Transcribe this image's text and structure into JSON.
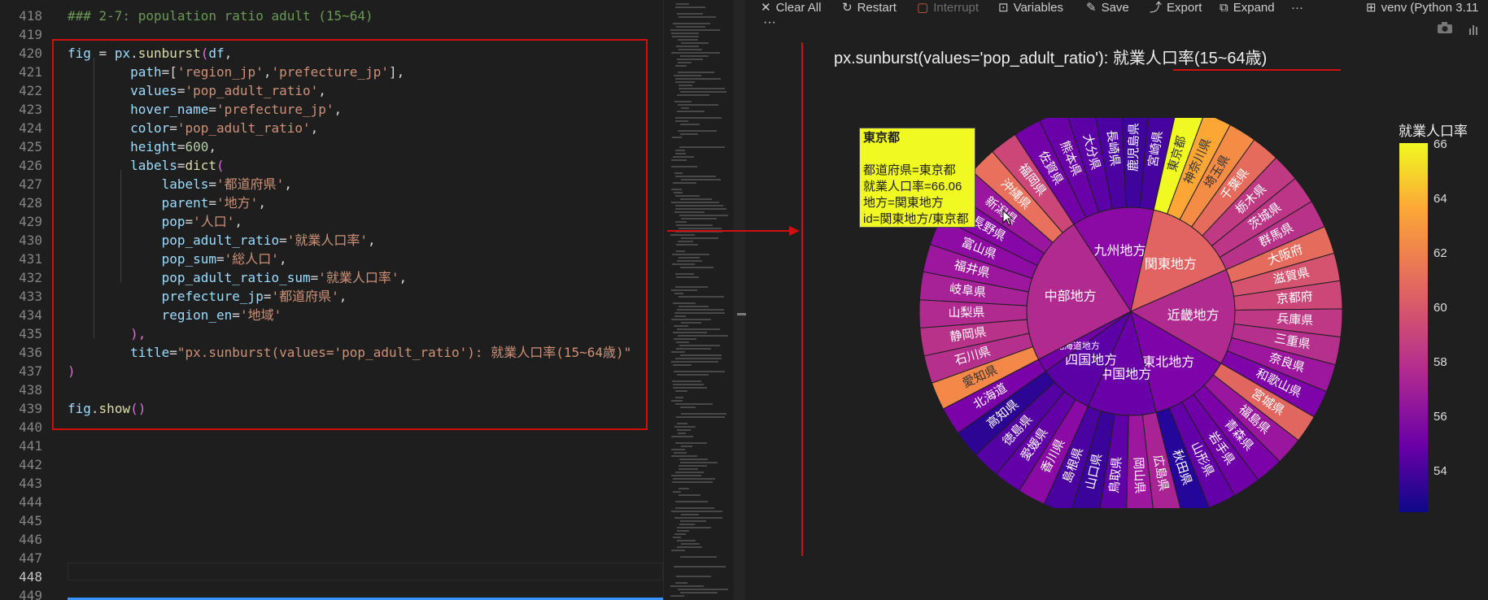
{
  "editor": {
    "line_numbers": [
      "418",
      "419",
      "420",
      "421",
      "422",
      "423",
      "424",
      "425",
      "426",
      "427",
      "428",
      "429",
      "430",
      "431",
      "432",
      "433",
      "434",
      "435",
      "436",
      "437",
      "438",
      "439",
      "440",
      "441",
      "442",
      "443",
      "444",
      "445",
      "446",
      "447",
      "448",
      "449"
    ],
    "lines": [
      [
        {
          "t": "### 2-7: population ratio adult (15~64)",
          "c": "k-cm"
        }
      ],
      [],
      [
        {
          "t": "fig",
          "c": "k-var"
        },
        {
          "t": " = ",
          "c": "k-op"
        },
        {
          "t": "px",
          "c": "k-var"
        },
        {
          "t": ".",
          "c": "k-op"
        },
        {
          "t": "sunburst",
          "c": "k-fn"
        },
        {
          "t": "(",
          "c": "k-br"
        },
        {
          "t": "df",
          "c": "k-var"
        },
        {
          "t": ",",
          "c": "k-op"
        }
      ],
      [
        {
          "t": "        path",
          "c": "k-var"
        },
        {
          "t": "=[",
          "c": "k-op"
        },
        {
          "t": "'region_jp'",
          "c": "k-str"
        },
        {
          "t": ",",
          "c": "k-op"
        },
        {
          "t": "'prefecture_jp'",
          "c": "k-str"
        },
        {
          "t": "],",
          "c": "k-op"
        }
      ],
      [
        {
          "t": "        values",
          "c": "k-var"
        },
        {
          "t": "=",
          "c": "k-op"
        },
        {
          "t": "'pop_adult_ratio'",
          "c": "k-str"
        },
        {
          "t": ",",
          "c": "k-op"
        }
      ],
      [
        {
          "t": "        hover_name",
          "c": "k-var"
        },
        {
          "t": "=",
          "c": "k-op"
        },
        {
          "t": "'prefecture_jp'",
          "c": "k-str"
        },
        {
          "t": ",",
          "c": "k-op"
        }
      ],
      [
        {
          "t": "        color",
          "c": "k-var"
        },
        {
          "t": "=",
          "c": "k-op"
        },
        {
          "t": "'pop_adult_ratio'",
          "c": "k-str"
        },
        {
          "t": ",",
          "c": "k-op"
        }
      ],
      [
        {
          "t": "        height",
          "c": "k-var"
        },
        {
          "t": "=",
          "c": "k-op"
        },
        {
          "t": "600",
          "c": "k-num"
        },
        {
          "t": ",",
          "c": "k-op"
        }
      ],
      [
        {
          "t": "        labels",
          "c": "k-var"
        },
        {
          "t": "=",
          "c": "k-op"
        },
        {
          "t": "dict",
          "c": "k-fn"
        },
        {
          "t": "(",
          "c": "k-br"
        }
      ],
      [
        {
          "t": "            labels",
          "c": "k-var"
        },
        {
          "t": "=",
          "c": "k-op"
        },
        {
          "t": "'都道府県'",
          "c": "k-str"
        },
        {
          "t": ",",
          "c": "k-op"
        }
      ],
      [
        {
          "t": "            parent",
          "c": "k-var"
        },
        {
          "t": "=",
          "c": "k-op"
        },
        {
          "t": "'地方'",
          "c": "k-str"
        },
        {
          "t": ",",
          "c": "k-op"
        }
      ],
      [
        {
          "t": "            pop",
          "c": "k-var"
        },
        {
          "t": "=",
          "c": "k-op"
        },
        {
          "t": "'人口'",
          "c": "k-str"
        },
        {
          "t": ",",
          "c": "k-op"
        }
      ],
      [
        {
          "t": "            pop_adult_ratio",
          "c": "k-var"
        },
        {
          "t": "=",
          "c": "k-op"
        },
        {
          "t": "'就業人口率'",
          "c": "k-str"
        },
        {
          "t": ",",
          "c": "k-op"
        }
      ],
      [
        {
          "t": "            pop_sum",
          "c": "k-var"
        },
        {
          "t": "=",
          "c": "k-op"
        },
        {
          "t": "'総人口'",
          "c": "k-str"
        },
        {
          "t": ",",
          "c": "k-op"
        }
      ],
      [
        {
          "t": "            pop_adult_ratio_sum",
          "c": "k-var"
        },
        {
          "t": "=",
          "c": "k-op"
        },
        {
          "t": "'就業人口率'",
          "c": "k-str"
        },
        {
          "t": ",",
          "c": "k-op"
        }
      ],
      [
        {
          "t": "            prefecture_jp",
          "c": "k-var"
        },
        {
          "t": "=",
          "c": "k-op"
        },
        {
          "t": "'都道府県'",
          "c": "k-str"
        },
        {
          "t": ",",
          "c": "k-op"
        }
      ],
      [
        {
          "t": "            region_en",
          "c": "k-var"
        },
        {
          "t": "=",
          "c": "k-op"
        },
        {
          "t": "'地域'",
          "c": "k-str"
        }
      ],
      [
        {
          "t": "        ),",
          "c": "k-br"
        }
      ],
      [
        {
          "t": "        title",
          "c": "k-var"
        },
        {
          "t": "=",
          "c": "k-op"
        },
        {
          "t": "\"px.sunburst(values='pop_adult_ratio'): 就業人口率(15~64歳)\"",
          "c": "k-str"
        }
      ],
      [
        {
          "t": ")",
          "c": "k-br"
        }
      ],
      [],
      [
        {
          "t": "fig",
          "c": "k-var"
        },
        {
          "t": ".",
          "c": "k-op"
        },
        {
          "t": "show",
          "c": "k-fn"
        },
        {
          "t": "()",
          "c": "k-br"
        }
      ],
      [],
      [],
      [],
      [],
      [],
      [],
      [],
      [],
      [],
      []
    ],
    "active_line": "448"
  },
  "toolbar": {
    "clear_all": "Clear All",
    "restart": "Restart",
    "interrupt": "Interrupt",
    "variables": "Variables",
    "save": "Save",
    "export": "Export",
    "expand": "Expand",
    "more": "···",
    "kernel": "venv (Python 3.11",
    "icons": [
      "close-icon",
      "restart-icon",
      "stop-icon",
      "variables-icon",
      "save-icon",
      "export-icon",
      "expand-icon",
      "ellipsis-icon",
      "kernel-icon"
    ]
  },
  "output_more": "···",
  "chart_title": "px.sunburst(values='pop_adult_ratio'): 就業人口率(15~64歳)",
  "tooltip": {
    "name": "東京都",
    "line1": "都道府県=東京都",
    "line2": "就業人口率=66.06",
    "line3": "地方=関東地方",
    "line4": "id=関東地方/東京都"
  },
  "chart_data": {
    "type": "sunburst",
    "title": "px.sunburst(values='pop_adult_ratio'): 就業人口率(15~64歳)",
    "colorbar": {
      "title": "就業人口率",
      "ticks": [
        54,
        56,
        58,
        60,
        62,
        64,
        66
      ],
      "range": [
        52.5,
        66.06
      ]
    },
    "regions": [
      {
        "name": "九州地方",
        "color": "#8b0aa5",
        "children": [
          {
            "name": "佐賀県",
            "color": "#7201a8"
          },
          {
            "name": "熊本県",
            "color": "#6a00a8"
          },
          {
            "name": "大分県",
            "color": "#5c01a6"
          },
          {
            "name": "長崎県",
            "color": "#4c02a1"
          },
          {
            "name": "鹿児島県",
            "color": "#3e049c"
          },
          {
            "name": "宮崎県",
            "color": "#46039f"
          }
        ]
      },
      {
        "name": "関東地方",
        "color": "#e16462",
        "children": [
          {
            "name": "東京都",
            "color": "#f0f921",
            "value": 66.06
          },
          {
            "name": "神奈川県",
            "color": "#fca636"
          },
          {
            "name": "埼玉県",
            "color": "#f58c46"
          },
          {
            "name": "千葉県",
            "color": "#e56b5d"
          },
          {
            "name": "栃木県",
            "color": "#c03a83"
          },
          {
            "name": "茨城県",
            "color": "#bc3587"
          },
          {
            "name": "群馬県",
            "color": "#b83289"
          }
        ]
      },
      {
        "name": "近畿地方",
        "color": "#b12a90",
        "children": [
          {
            "name": "大阪府",
            "color": "#e56b5d"
          },
          {
            "name": "滋賀県",
            "color": "#d5536f"
          },
          {
            "name": "京都府",
            "color": "#cc4778"
          },
          {
            "name": "兵庫県",
            "color": "#be3885"
          },
          {
            "name": "三重県",
            "color": "#b52f8c"
          },
          {
            "name": "奈良県",
            "color": "#9c179e"
          },
          {
            "name": "和歌山県",
            "color": "#7e03a8"
          }
        ]
      },
      {
        "name": "東北地方",
        "color": "#7e03a8",
        "children": [
          {
            "name": "宮城県",
            "color": "#e0665f"
          },
          {
            "name": "福島県",
            "color": "#9a169f"
          },
          {
            "name": "青森県",
            "color": "#7b02a8"
          },
          {
            "name": "岩手県",
            "color": "#6f00a8"
          },
          {
            "name": "山形県",
            "color": "#6300a7"
          },
          {
            "name": "秋田県",
            "color": "#24069a"
          }
        ]
      },
      {
        "name": "中国地方",
        "color": "#6a00a8",
        "children": [
          {
            "name": "広島県",
            "color": "#a92395"
          },
          {
            "name": "岡山県",
            "color": "#9c179e"
          },
          {
            "name": "鳥取県",
            "color": "#5e01a6"
          },
          {
            "name": "山口県",
            "color": "#3a049a"
          },
          {
            "name": "島根県",
            "color": "#4a02a0"
          }
        ]
      },
      {
        "name": "四国地方",
        "color": "#5c01a6",
        "children": [
          {
            "name": "香川県",
            "color": "#8b0aa5"
          },
          {
            "name": "愛媛県",
            "color": "#6300a7"
          },
          {
            "name": "徳島県",
            "color": "#5402a3"
          },
          {
            "name": "高知県",
            "color": "#2c0594"
          }
        ]
      },
      {
        "name": "北海道地方",
        "color": "#7201a8",
        "children": [
          {
            "name": "北海道",
            "color": "#7a02a8"
          }
        ]
      },
      {
        "name": "中部地方",
        "color": "#b12a90",
        "children": [
          {
            "name": "愛知県",
            "color": "#f48849"
          },
          {
            "name": "石川県",
            "color": "#b52f8c"
          },
          {
            "name": "静岡県",
            "color": "#b83289"
          },
          {
            "name": "山梨県",
            "color": "#b12a90"
          },
          {
            "name": "岐阜県",
            "color": "#a72197"
          },
          {
            "name": "福井県",
            "color": "#9c179e"
          },
          {
            "name": "富山県",
            "color": "#8e0ca4"
          },
          {
            "name": "長野県",
            "color": "#8707a6"
          },
          {
            "name": "新潟県",
            "color": "#9a169f"
          },
          {
            "name": "沖縄県",
            "color": "#e8705c"
          },
          {
            "name": "福岡県",
            "color": "#cc4778"
          }
        ]
      }
    ]
  }
}
